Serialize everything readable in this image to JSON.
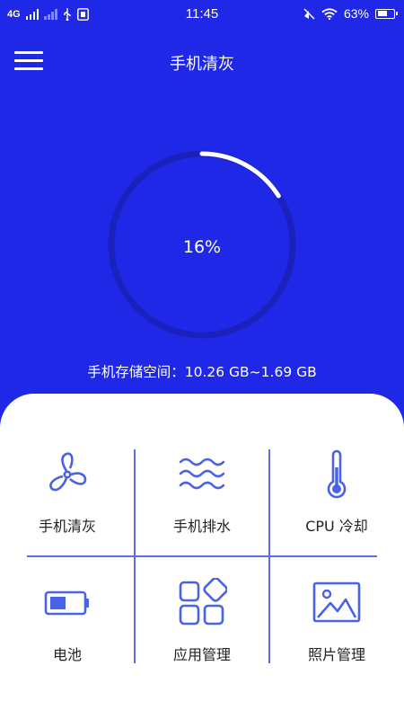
{
  "status_bar": {
    "network": "4G",
    "time": "11:45",
    "battery_percent_text": "63%",
    "battery_level": 0.63
  },
  "app_bar": {
    "title": "手机清灰"
  },
  "gauge": {
    "percent_text": "16%",
    "progress": 0.16
  },
  "storage": {
    "text": "手机存储空间：10.26 GB~1.69 GB"
  },
  "tools": [
    {
      "label": "手机清灰",
      "icon": "fan-icon"
    },
    {
      "label": "手机排水",
      "icon": "water-waves-icon"
    },
    {
      "label": "CPU 冷却",
      "icon": "thermometer-icon"
    },
    {
      "label": "电池",
      "icon": "battery-icon"
    },
    {
      "label": "应用管理",
      "icon": "app-grid-icon"
    },
    {
      "label": "照片管理",
      "icon": "photo-icon"
    }
  ],
  "colors": {
    "background": "#1f28e6",
    "gauge_track": "#1a22bd",
    "gauge_progress": "#ffffff",
    "accent": "#4a63e6",
    "divider": "#5d6ee0"
  }
}
